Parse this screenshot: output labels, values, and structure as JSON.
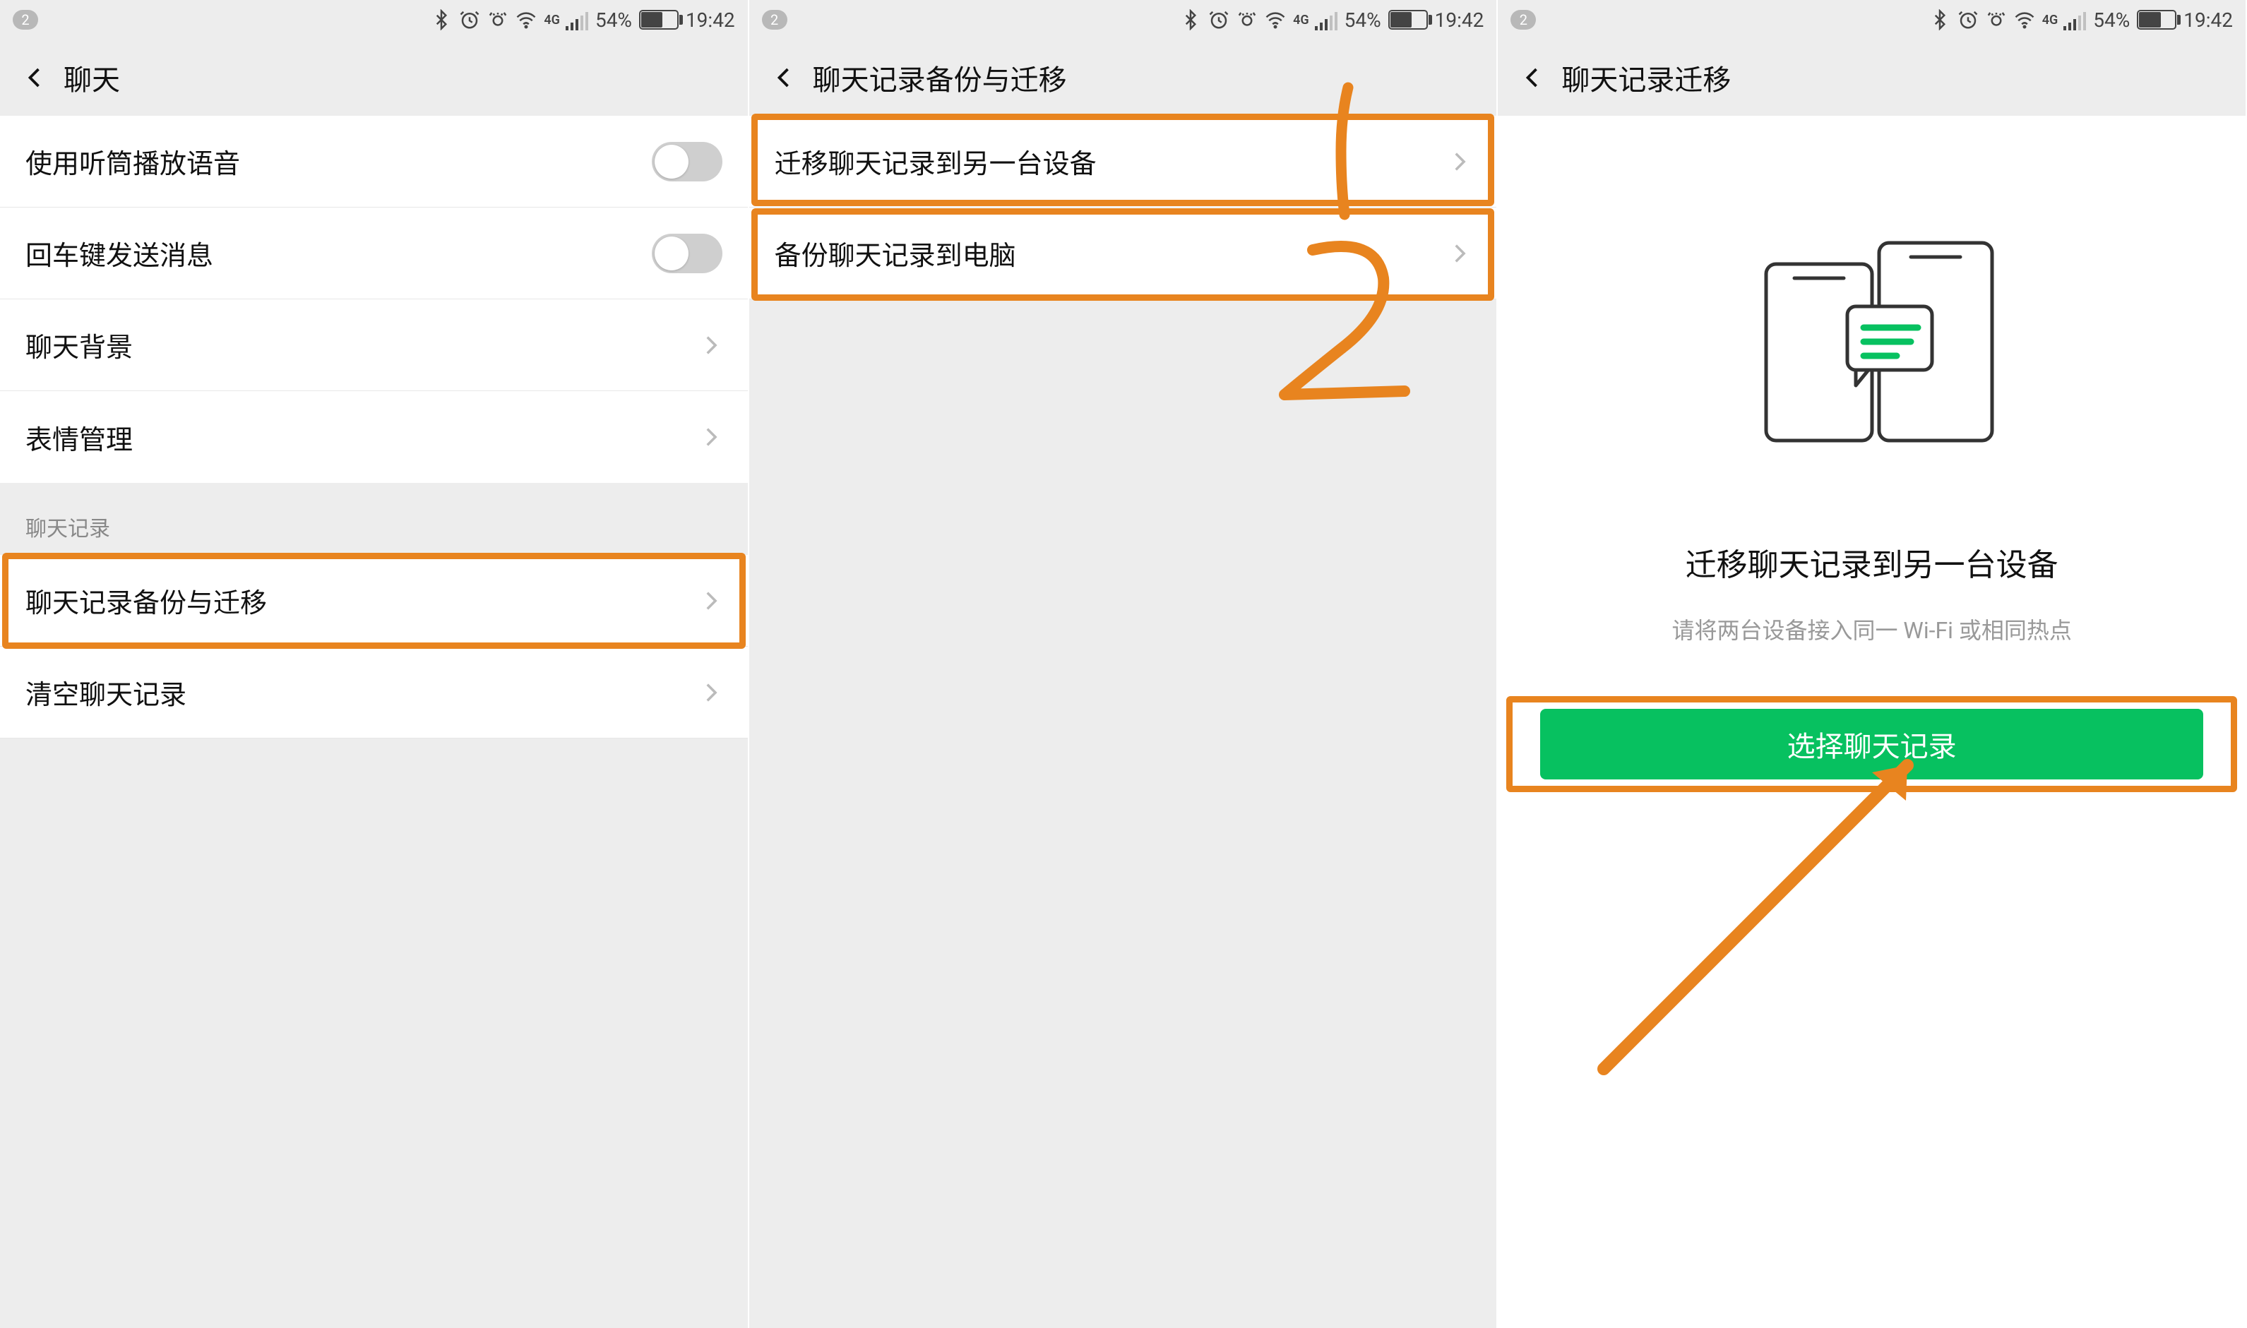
{
  "statusbar": {
    "notification_count": "2",
    "network_label": "4G",
    "battery_pct": "54%",
    "time": "19:42"
  },
  "screen1": {
    "title": "聊天",
    "cells": {
      "use_earpiece": "使用听筒播放语音",
      "enter_send": "回车键发送消息",
      "chat_bg": "聊天背景",
      "sticker_mgmt": "表情管理",
      "section_chatlog": "聊天记录",
      "backup_migrate": "聊天记录备份与迁移",
      "clear_chatlog": "清空聊天记录"
    }
  },
  "screen2": {
    "title": "聊天记录备份与迁移",
    "cells": {
      "migrate_device": "迁移聊天记录到另一台设备",
      "backup_pc": "备份聊天记录到电脑"
    },
    "annotations": {
      "one": "1",
      "two": "2"
    }
  },
  "screen3": {
    "title": "聊天记录迁移",
    "heading": "迁移聊天记录到另一台设备",
    "subtext": "请将两台设备接入同一 Wi-Fi 或相同热点",
    "button": "选择聊天记录"
  },
  "colors": {
    "highlight": "#e8841f",
    "primary_btn": "#07c160"
  }
}
